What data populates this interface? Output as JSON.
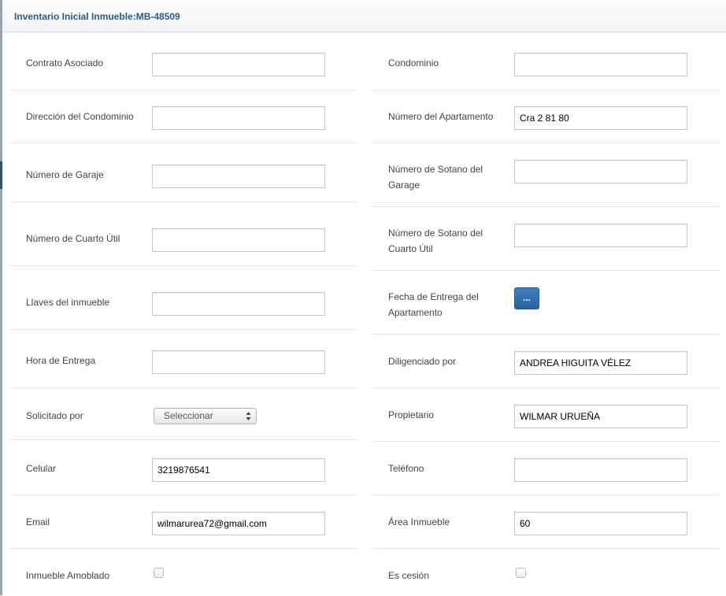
{
  "header": {
    "title": "Inventario Inicial Inmueble:MB-48509"
  },
  "left": {
    "contrato": {
      "label": "Contrato Asociado",
      "value": ""
    },
    "direccion": {
      "label": "Dirección del Condominio",
      "value": ""
    },
    "garaje": {
      "label": "Número de Garaje",
      "value": ""
    },
    "cuarto": {
      "label": "Número de Cuarto Útil",
      "value": ""
    },
    "llaves": {
      "label": "Llaves del inmueble",
      "value": ""
    },
    "hora": {
      "label": "Hora de Entrega",
      "value": ""
    },
    "solicitado": {
      "label": "Solicitado por",
      "selected": "Seleccionar"
    },
    "celular": {
      "label": "Celular",
      "value": "3219876541"
    },
    "email": {
      "label": "Email",
      "value": "wilmarurea72@gmail.com"
    },
    "amoblado": {
      "label": "Inmueble Amoblado",
      "checked": false
    }
  },
  "right": {
    "condominio": {
      "label": "Condominio",
      "value": ""
    },
    "apartamento": {
      "label": "Número del Apartamento",
      "value": "Cra 2 81 80"
    },
    "sotano_garage": {
      "label_line1": "Número de Sotano del",
      "label_line2": "Garage",
      "value": ""
    },
    "sotano_cuarto": {
      "label_line1": "Número de Sotano del",
      "label_line2": "Cuarto Útil",
      "value": ""
    },
    "fecha": {
      "label_line1": "Fecha de Entrega del",
      "label_line2": "Apartamento",
      "button": "..."
    },
    "diligenciado": {
      "label": "Diligenciado por",
      "value": "ANDREA HIGUITA VÉLEZ"
    },
    "propietario": {
      "label": "Propietario",
      "value": "WILMAR URUEÑA"
    },
    "telefono": {
      "label": "Teléfono",
      "value": ""
    },
    "area": {
      "label": "Área Inmueble",
      "value": "60"
    },
    "cesion": {
      "label": "Es cesión",
      "checked": false
    }
  },
  "colors": {
    "title": "#2a5a8a",
    "button": "#2f6dab",
    "divider": "#e5e5e5"
  }
}
